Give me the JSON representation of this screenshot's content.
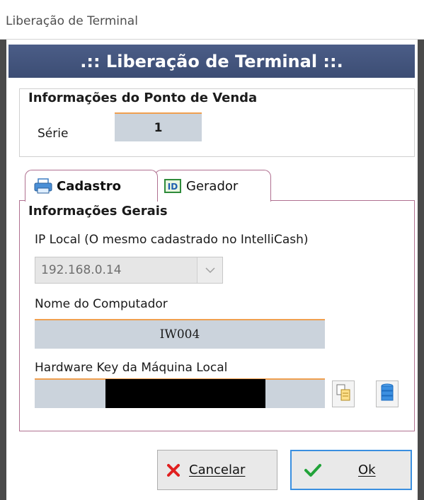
{
  "window": {
    "title": "Liberação de Terminal"
  },
  "header": {
    "title": ".:: Liberação de Terminal ::."
  },
  "pdv_group": {
    "title": "Informações do Ponto de Venda",
    "serie_label": "Série",
    "serie_value": "1"
  },
  "tabs": [
    {
      "label": "Cadastro",
      "icon": "printer-icon",
      "active": true
    },
    {
      "label": "Gerador",
      "icon": "id-icon",
      "active": false
    }
  ],
  "general": {
    "title": "Informações Gerais",
    "ip_label": "IP Local (O mesmo cadastrado no IntelliCash)",
    "ip_value": "192.168.0.14",
    "computer_label": "Nome do Computador",
    "computer_value": "IW004",
    "hwkey_label": "Hardware Key da Máquina Local",
    "hwkey_value": ""
  },
  "buttons": {
    "cancel": "Cancelar",
    "ok": "Ok"
  },
  "colors": {
    "header_bg": "#44557d",
    "field_bg": "#cbd3dc",
    "field_accent": "#f0a050",
    "tab_border": "#b07090",
    "ok_border": "#3a8fe0"
  }
}
